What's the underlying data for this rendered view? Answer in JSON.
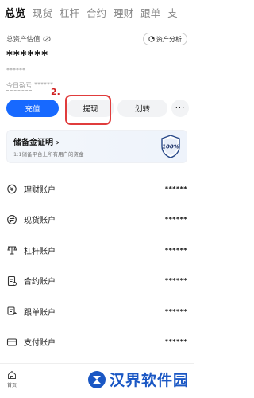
{
  "tabs": [
    "总览",
    "现货",
    "杠杆",
    "合约",
    "理财",
    "跟单",
    "支"
  ],
  "asset": {
    "label": "总资产估值",
    "analysis_button": "资产分析",
    "value": "******",
    "sub": "******",
    "pnl_label": "今日盈亏",
    "pnl_value": "******"
  },
  "annotation": "2.",
  "actions": {
    "deposit": "充值",
    "withdraw": "提现",
    "transfer": "划转",
    "more": "···"
  },
  "reserve": {
    "title": "储备金证明 ›",
    "subtitle": "1:1储备平台上所有用户的资金",
    "badge": "100%"
  },
  "accounts": [
    {
      "label": "理财账户",
      "value": "******",
      "icon": "piggy-bank-icon"
    },
    {
      "label": "现货账户",
      "value": "******",
      "icon": "exchange-icon"
    },
    {
      "label": "杠杆账户",
      "value": "******",
      "icon": "scale-icon"
    },
    {
      "label": "合约账户",
      "value": "******",
      "icon": "contract-icon"
    },
    {
      "label": "跟单账户",
      "value": "******",
      "icon": "copy-trade-icon"
    },
    {
      "label": "支付账户",
      "value": "******",
      "icon": "card-icon"
    }
  ],
  "bottom_nav": {
    "home": "首页"
  },
  "watermark": {
    "text": "汉界软件园"
  },
  "colors": {
    "primary": "#1769ff",
    "highlight": "#e03c3c",
    "watermark": "#1a57c4"
  }
}
